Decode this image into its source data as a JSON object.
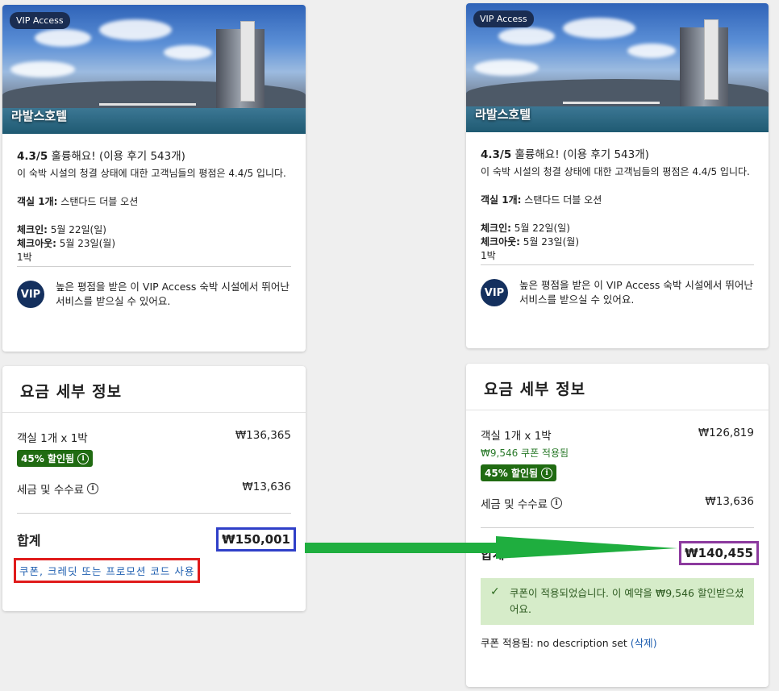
{
  "hotel": {
    "badge": "VIP Access",
    "name": "라발스호텔",
    "score": "4.3/5",
    "rating_word": "훌륭해요!",
    "reviews": "(이용 후기 543개)",
    "clean_text": "이 숙박 시설의 청결 상태에 대한 고객님들의 평점은 4.4/5 입니다.",
    "room_label": "객실 1개:",
    "room_value": "스탠다드 더블 오션",
    "checkin_label": "체크인:",
    "checkin_value": "5월 22일(일)",
    "checkout_label": "체크아웃:",
    "checkout_value": "5월 23일(월)",
    "nights": "1박",
    "vip_circle": "VIP",
    "vip_text": "높은 평점을 받은 이 VIP Access 숙박 시설에서 뛰어난 서비스를 받으실 수 있어요."
  },
  "left": {
    "title": "요금 세부 정보",
    "room_line": "객실 1개 x 1박",
    "room_price": "₩136,365",
    "discount": "45% 할인됨",
    "tax_label": "세금 및 수수료",
    "tax_price": "₩13,636",
    "total_label": "합계",
    "total_price": "₩150,001",
    "promo_link": "쿠폰, 크레딧 또는 프로모션 코드 사용"
  },
  "right": {
    "title": "요금 세부 정보",
    "room_line": "객실 1개 x 1박",
    "room_price": "₩126,819",
    "coupon_applied": "₩9,546 쿠폰 적용됨",
    "discount": "45% 할인됨",
    "tax_label": "세금 및 수수료",
    "tax_price": "₩13,636",
    "total_label": "합계",
    "total_price": "₩140,455",
    "success_msg": "쿠폰이 적용되었습니다. 이 예약을 ₩9,546 할인받으셨어요.",
    "coupon_label": "쿠폰 적용됨:",
    "coupon_desc": "no description set",
    "remove_open": "(",
    "remove_link": "삭제",
    "remove_close": ")"
  },
  "colors": {
    "blue_box": "#2f3fc8",
    "red_box": "#e01b1b",
    "purple_box": "#8c3a9e",
    "arrow": "#1fae3f"
  }
}
